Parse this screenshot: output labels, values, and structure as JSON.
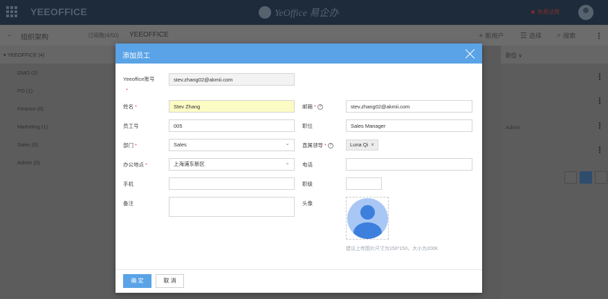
{
  "app": {
    "brand": "YEEOFFICE",
    "center_logo_text": "YeOffice 易企办",
    "trial_label": "免费试用"
  },
  "subbar": {
    "back_glyph": "←",
    "org_title": "组织架构",
    "subscription": "订阅数(4/50)",
    "company": "YEEOFFICE",
    "add_user": "新用户",
    "select": "选择",
    "search": "搜索"
  },
  "tree": {
    "root": "▾ YEEOFFICE (4)",
    "departments": [
      "GMO (2)",
      "PO (1)",
      "Finance (0)",
      "Marketing (1)",
      "Sales (0)",
      "Admin (0)"
    ]
  },
  "right_table": {
    "column_header": "职位 ∨",
    "row_value": "Admin",
    "pager_label": "1"
  },
  "modal": {
    "title": "添加员工",
    "account_label": "Yeeoffice账号",
    "account_value": "stev.zhang02@akmii.com",
    "name_label": "姓名",
    "name_value": "Stev Zhang",
    "email_label": "邮箱",
    "email_value": "stev.zhang02@akmii.com",
    "empno_label": "员工号",
    "empno_value": "005",
    "position_label": "职位",
    "position_value": "Sales Manager",
    "dept_label": "部门",
    "dept_value": "Sales",
    "manager_label": "直属领导",
    "manager_tag": "Luna Qi",
    "office_label": "办公地点",
    "office_value": "上海浦东新区",
    "phone_label": "电话",
    "phone_value": "",
    "mobile_label": "手机",
    "mobile_value": "",
    "level_label": "职级",
    "level_value": "",
    "note_label": "备注",
    "note_value": "",
    "avatar_label": "头像",
    "avatar_hint": "建议上传图片尺寸为150*150，大小为200K",
    "ok_label": "确 定",
    "cancel_label": "取 消",
    "required_mark": "*",
    "help_mark": "?"
  },
  "colors": {
    "accent": "#5aa3e6",
    "required": "#e0483b",
    "highlight_field": "#fbfbc4",
    "avatar_fill": "#3d7fdc",
    "avatar_bg": "#a9c7f5"
  },
  "icons": [
    "apps-grid-icon",
    "close-icon",
    "help-circle-icon",
    "chevron-down-icon",
    "plus-icon",
    "list-icon",
    "search-icon",
    "more-vert-icon",
    "user-avatar-icon"
  ]
}
